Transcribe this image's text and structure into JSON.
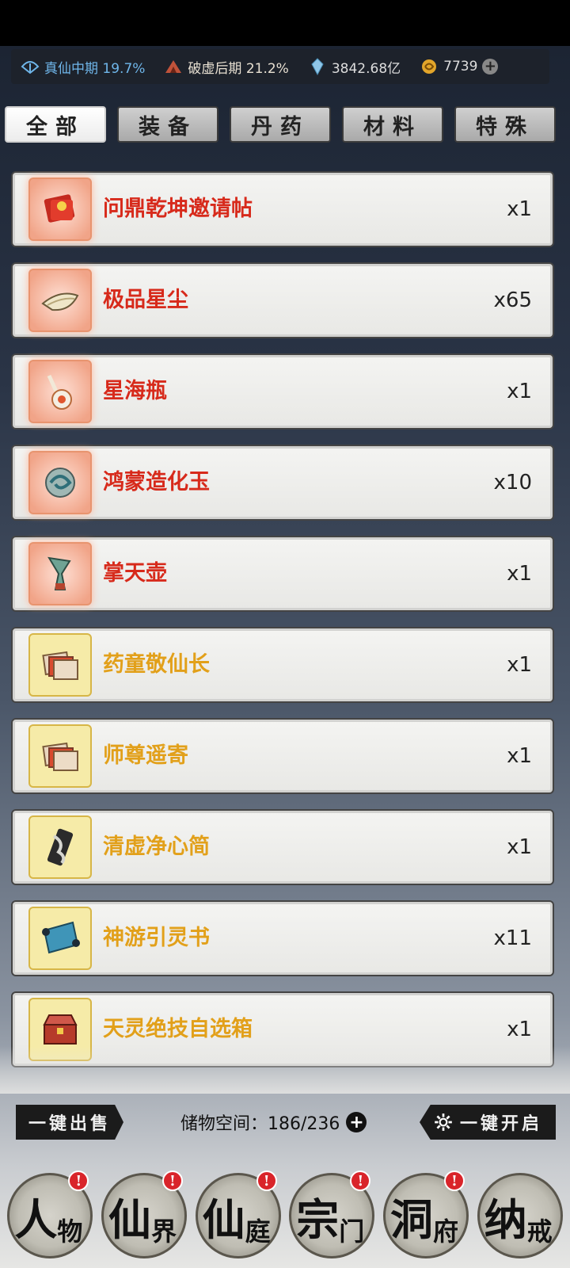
{
  "resources": {
    "realm_primary": "真仙中期 19.7%",
    "realm_secondary": "破虚后期 21.2%",
    "spirit_stones": "3842.68亿",
    "jade": "7739"
  },
  "tabs": [
    {
      "label": "全部",
      "active": true
    },
    {
      "label": "装备",
      "active": false
    },
    {
      "label": "丹药",
      "active": false
    },
    {
      "label": "材料",
      "active": false
    },
    {
      "label": "特殊",
      "active": false
    }
  ],
  "items": [
    {
      "name": "问鼎乾坤邀请帖",
      "qty": "x1",
      "rarity": "red",
      "icon": "invitation-card-icon"
    },
    {
      "name": "极品星尘",
      "qty": "x65",
      "rarity": "red",
      "icon": "star-dust-icon"
    },
    {
      "name": "星海瓶",
      "qty": "x1",
      "rarity": "red",
      "icon": "star-sea-bottle-icon"
    },
    {
      "name": "鸿蒙造化玉",
      "qty": "x10",
      "rarity": "red",
      "icon": "jade-orb-icon"
    },
    {
      "name": "掌天壶",
      "qty": "x1",
      "rarity": "red",
      "icon": "heaven-vase-icon"
    },
    {
      "name": "药童敬仙长",
      "qty": "x1",
      "rarity": "gold",
      "icon": "letter-stack-icon"
    },
    {
      "name": "师尊遥寄",
      "qty": "x1",
      "rarity": "gold",
      "icon": "letter-stack-icon"
    },
    {
      "name": "清虚净心简",
      "qty": "x1",
      "rarity": "gold",
      "icon": "bamboo-slip-icon"
    },
    {
      "name": "神游引灵书",
      "qty": "x11",
      "rarity": "gold",
      "icon": "scroll-book-icon"
    },
    {
      "name": "天灵绝技自选箱",
      "qty": "x1",
      "rarity": "gold",
      "icon": "treasure-chest-icon"
    }
  ],
  "actions": {
    "sell_all": "一键出售",
    "open_all": "一键开启",
    "storage_label": "储物空间：186/236"
  },
  "nav": [
    {
      "big": "人",
      "small": "物",
      "badge": "!"
    },
    {
      "big": "仙",
      "small": "界",
      "badge": "!"
    },
    {
      "big": "仙",
      "small": "庭",
      "badge": "!"
    },
    {
      "big": "宗",
      "small": "门",
      "badge": "!"
    },
    {
      "big": "洞",
      "small": "府",
      "badge": "!"
    },
    {
      "big": "纳",
      "small": "戒",
      "badge": ""
    }
  ],
  "colors": {
    "rarity_red": "#d72a1b",
    "rarity_gold": "#e2a01a",
    "badge": "#d9242a"
  }
}
